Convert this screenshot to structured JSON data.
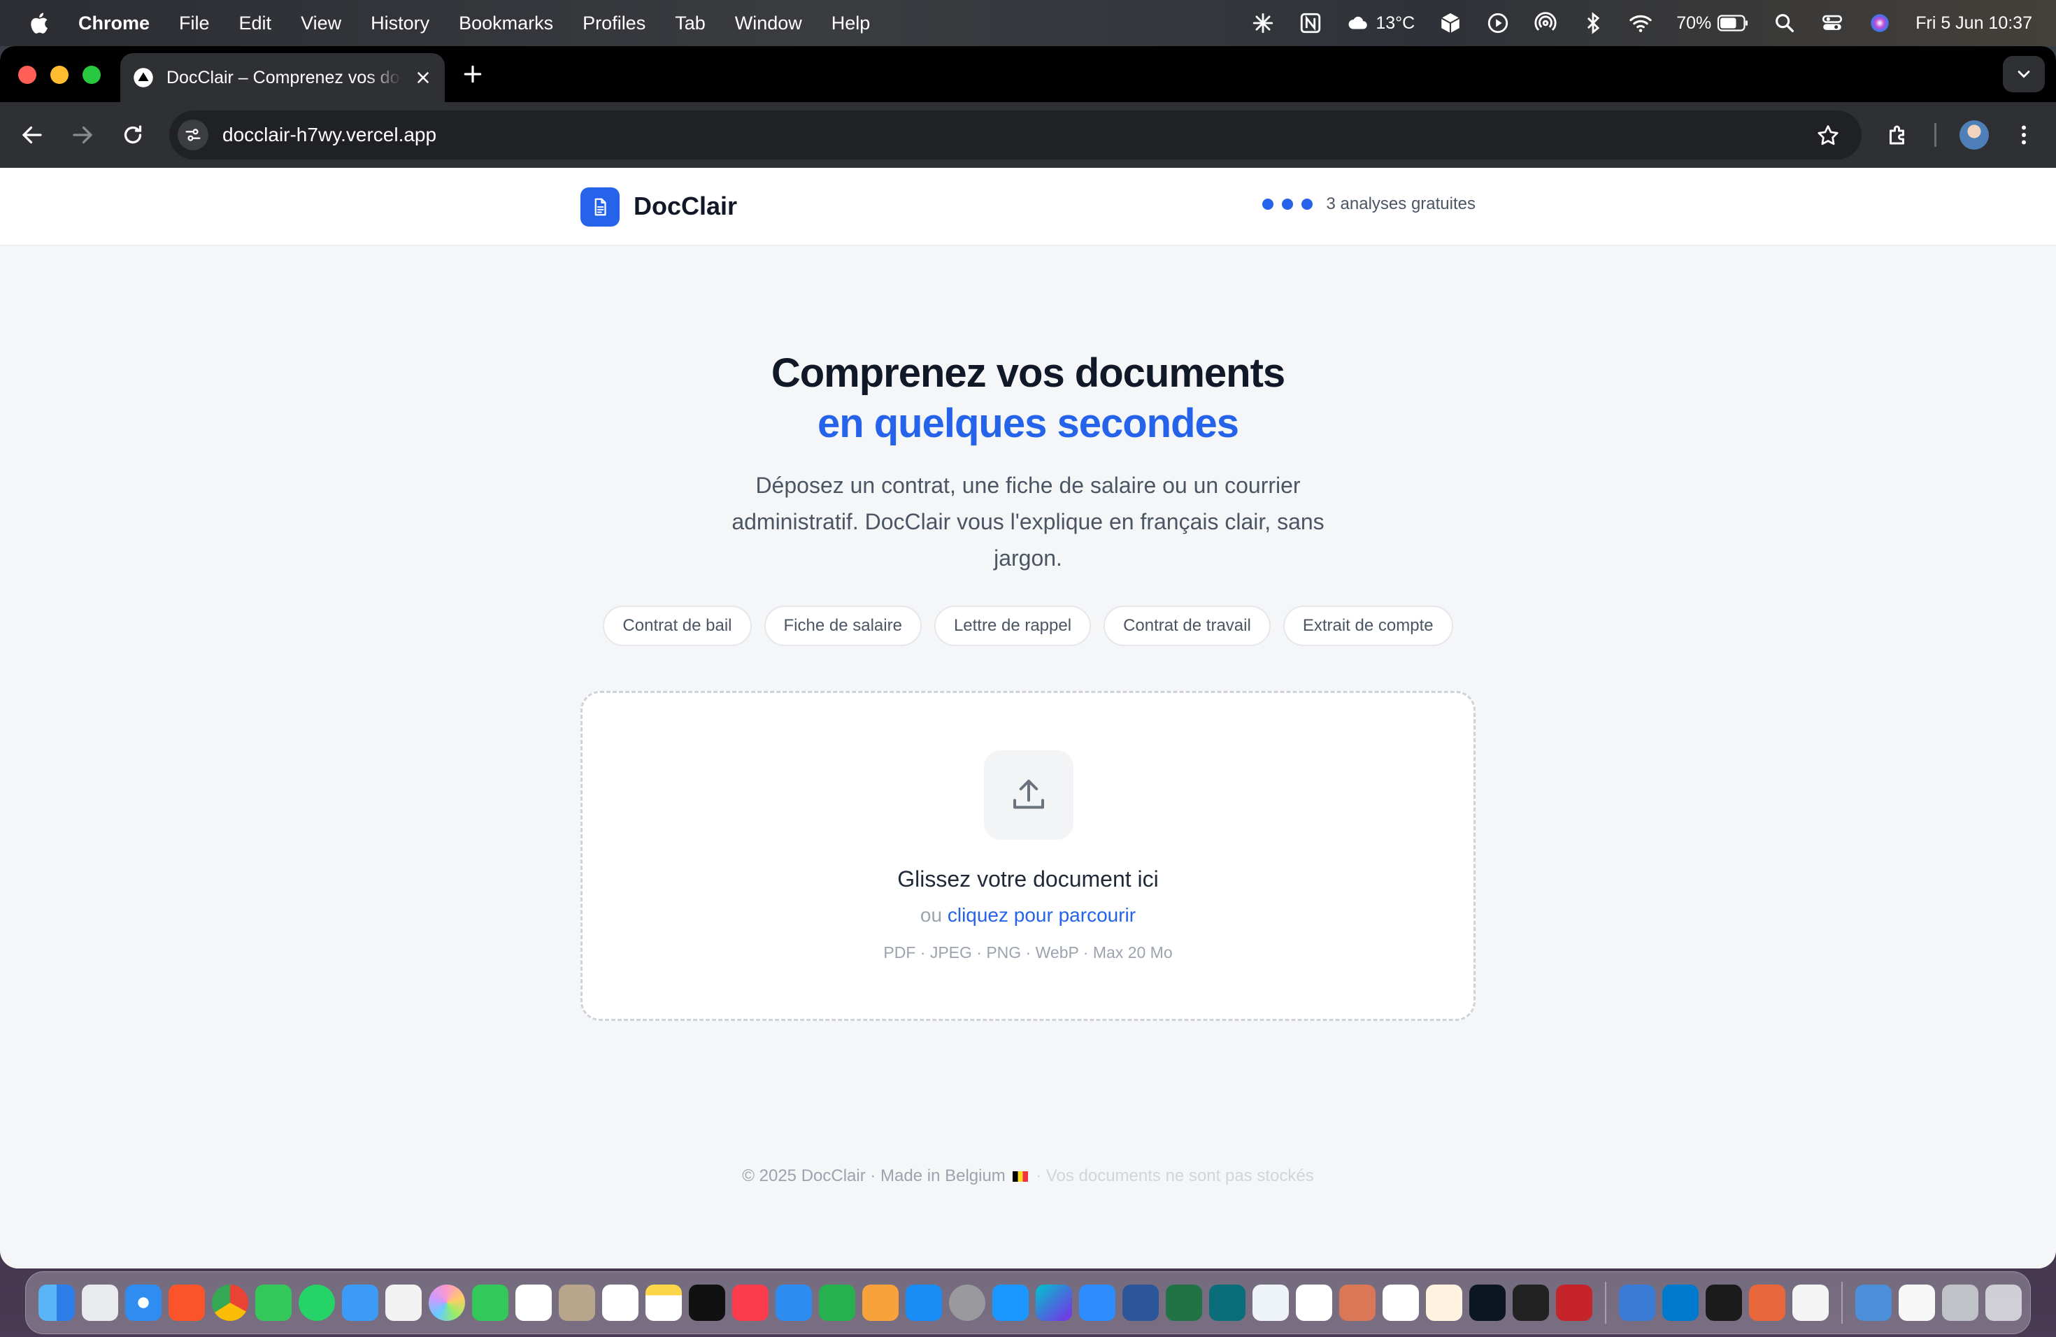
{
  "menubar": {
    "app_name": "Chrome",
    "items": [
      "File",
      "Edit",
      "View",
      "History",
      "Bookmarks",
      "Profiles",
      "Tab",
      "Window",
      "Help"
    ],
    "weather": "13°C",
    "battery": "70%",
    "datetime": "Fri 5 Jun  10:37"
  },
  "browser": {
    "tab_title": "DocClair – Comprenez vos documents",
    "url": "docclair-h7wy.vercel.app"
  },
  "site": {
    "logo": "DocClair",
    "credits_label": "3 analyses gratuites",
    "credits_dots": 3,
    "hero_line1": "Comprenez vos documents",
    "hero_line2": "en quelques secondes",
    "hero_sub": "Déposez un contrat, une fiche de salaire ou un courrier administratif. DocClair vous l'explique en français clair, sans jargon.",
    "chips": [
      "Contrat de bail",
      "Fiche de salaire",
      "Lettre de rappel",
      "Contrat de travail",
      "Extrait de compte"
    ],
    "dropzone": {
      "title": "Glissez votre document ici",
      "or": "ou",
      "browse": "cliquez pour parcourir",
      "formats": "PDF · JPEG · PNG · WebP · Max 20 Mo"
    },
    "footer": {
      "main": "© 2025 DocClair · Made in Belgium",
      "sep": " · ",
      "note": "Vos documents ne sont pas stockés"
    }
  },
  "colors": {
    "accent": "#2563eb",
    "text_dark": "#111827",
    "muted": "#9ca3af"
  }
}
